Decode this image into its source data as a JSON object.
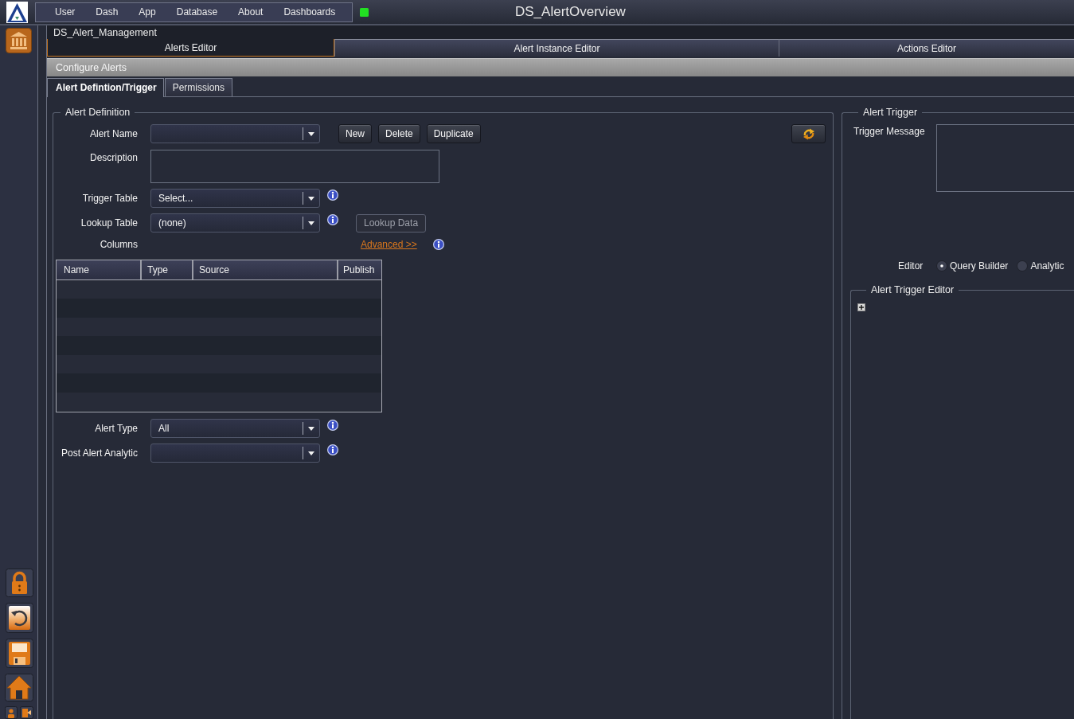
{
  "app_bar": {
    "menu": [
      "User",
      "Dash",
      "App",
      "Database",
      "About",
      "Dashboards"
    ],
    "online": true,
    "title": "DS_AlertOverview"
  },
  "page_name": "DS_Alert_Management",
  "main_tabs": [
    {
      "label": "Alerts Editor",
      "selected": true
    },
    {
      "label": "Alert Instance Editor",
      "selected": false
    },
    {
      "label": "Actions Editor",
      "selected": false
    }
  ],
  "section_title": "Configure Alerts",
  "sub_tabs": [
    {
      "label": "Alert Defintion/Trigger",
      "selected": true
    },
    {
      "label": "Permissions",
      "selected": false
    }
  ],
  "alert_definition": {
    "title": "Alert Definition",
    "alert_name": {
      "label": "Alert Name",
      "buttons": [
        "New",
        "Delete",
        "Duplicate"
      ]
    },
    "description": {
      "label": "Description"
    },
    "trigger_table": {
      "label": "Trigger Table",
      "value": "Select..."
    },
    "lookup_table": {
      "label": "Lookup Table",
      "value": "(none)",
      "button": {
        "label": "Lookup Data",
        "disabled": true
      }
    },
    "columns": {
      "label": "Columns",
      "link": "Advanced >>",
      "table": {
        "columns": [
          "Name",
          "Type",
          "Source",
          "Publish"
        ]
      }
    },
    "alert_type": {
      "label": "Alert Type",
      "value": "All"
    },
    "post_alert_analytic": {
      "label": "Post Alert Analytic"
    }
  },
  "alert_trigger": {
    "title": "Alert Trigger",
    "trigger_message": {
      "label": "Trigger Message"
    },
    "editor": {
      "label": "Editor",
      "options": [
        {
          "label": "Query Builder",
          "selected": true
        },
        {
          "label": "Analytic",
          "selected": false
        }
      ]
    },
    "trigger_editor": {
      "title": "Alert Trigger Editor"
    }
  }
}
